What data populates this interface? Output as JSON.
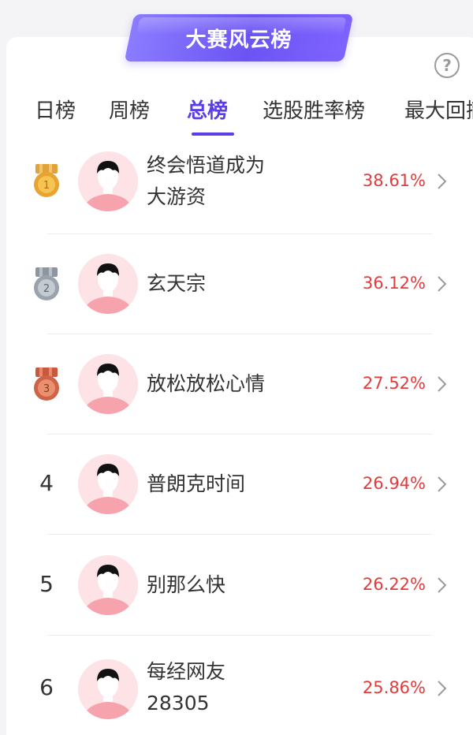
{
  "banner": {
    "title": "大赛风云榜"
  },
  "help": {
    "label": "?"
  },
  "tabs": [
    {
      "label": "日榜"
    },
    {
      "label": "周榜"
    },
    {
      "label": "总榜"
    },
    {
      "label": "选股胜率榜"
    },
    {
      "label": "最大回撤"
    }
  ],
  "colors": {
    "accent": "#5b3ee8",
    "positive": "#e23b3b",
    "banner": "#6b54f4"
  },
  "ranking": [
    {
      "rank": "1",
      "name_line1": "终会悟道成为",
      "name_line2": "大游资",
      "return": "38.61%",
      "medal": "gold"
    },
    {
      "rank": "2",
      "name_line1": "玄天宗",
      "name_line2": "",
      "return": "36.12%",
      "medal": "silver"
    },
    {
      "rank": "3",
      "name_line1": "放松放松心情",
      "name_line2": "",
      "return": "27.52%",
      "medal": "bronze"
    },
    {
      "rank": "4",
      "name_line1": "普朗克时间",
      "name_line2": "",
      "return": "26.94%",
      "medal": ""
    },
    {
      "rank": "5",
      "name_line1": "别那么快",
      "name_line2": "",
      "return": "26.22%",
      "medal": ""
    },
    {
      "rank": "6",
      "name_line1": "每经网友",
      "name_line2": "28305",
      "return": "25.86%",
      "medal": ""
    }
  ]
}
